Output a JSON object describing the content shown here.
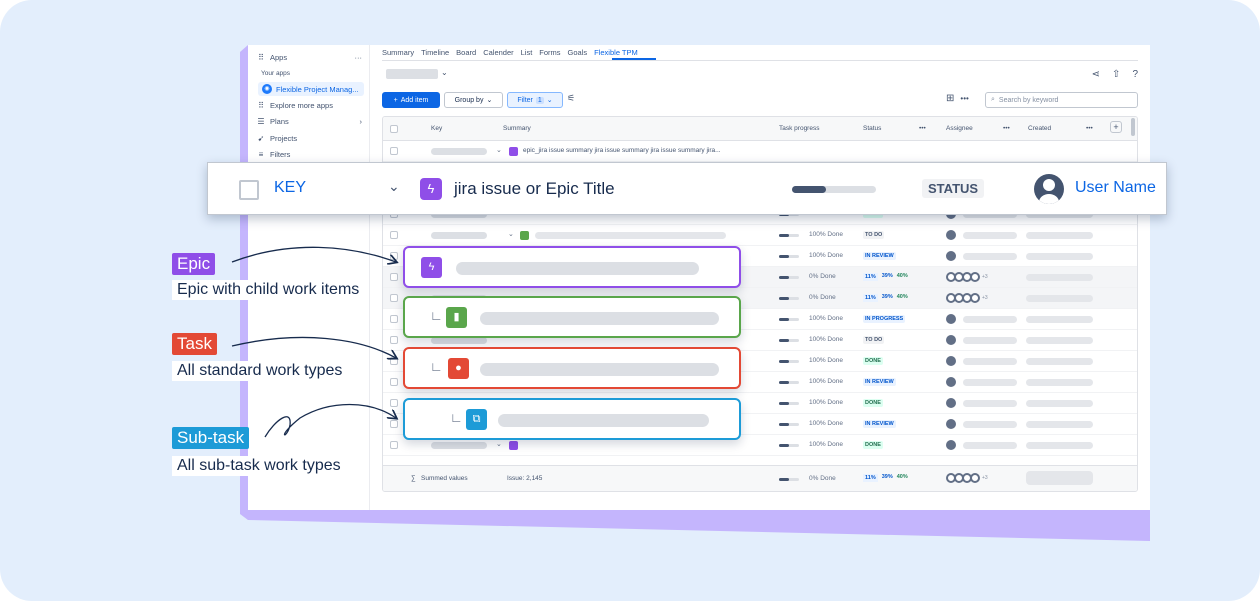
{
  "colors": {
    "background": "#e3eefc",
    "accent": "#0c66e4",
    "epic": "#8f4ee8",
    "story": "#5aa64b",
    "bug": "#e34935",
    "subtask": "#1d9bd7",
    "slab": "#c4b5fd"
  },
  "sidebar": {
    "apps": "Apps",
    "more": "···",
    "your_apps": "Your apps",
    "app_name": "Flexible Project Manag...",
    "explore": "Explore more apps",
    "plans": "Plans",
    "projects": "Projects",
    "filters": "Filters"
  },
  "tabs": [
    "Summary",
    "Timeline",
    "Board",
    "Calender",
    "List",
    "Forms",
    "Goals",
    "Flexible TPM"
  ],
  "toolbar": {
    "add_item": "Add item",
    "group_by": "Group by",
    "filter": "Filter",
    "filter_count": "1",
    "more": "•••",
    "search_placeholder": "Search by keyword"
  },
  "table": {
    "headers": {
      "key": "Key",
      "summary": "Summary",
      "task_progress": "Task progress",
      "status": "Status",
      "assignee": "Assignee",
      "created": "Created",
      "col_more": "•••"
    },
    "first_row_summary": "epic_jira issue summary jira issue summary jira issue summary jira...",
    "rows": [
      {
        "progress": "100% Done",
        "status": "IN PROGRESS",
        "kind": "prog"
      },
      {
        "progress": "100% Done",
        "status": "DONE",
        "kind": "done"
      },
      {
        "progress": "100% Done",
        "status": "TO DO",
        "kind": "todo"
      },
      {
        "progress": "100% Done",
        "status": "IN REVIEW",
        "kind": "rev"
      },
      {
        "progress": "0% Done",
        "status": "pct",
        "kind": "pct"
      },
      {
        "progress": "0% Done",
        "status": "pct",
        "kind": "pct"
      },
      {
        "progress": "100% Done",
        "status": "IN PROGRESS",
        "kind": "prog"
      },
      {
        "progress": "100% Done",
        "status": "TO DO",
        "kind": "todo"
      },
      {
        "progress": "100% Done",
        "status": "DONE",
        "kind": "done"
      },
      {
        "progress": "100% Done",
        "status": "IN REVIEW",
        "kind": "rev"
      },
      {
        "progress": "100% Done",
        "status": "DONE",
        "kind": "done"
      },
      {
        "progress": "100% Done",
        "status": "IN REVIEW",
        "kind": "rev"
      },
      {
        "progress": "100% Done",
        "status": "DONE",
        "kind": "done"
      }
    ],
    "pct": {
      "a": "11%",
      "b": "39%",
      "c": "40%"
    },
    "avatar_extra": "+3",
    "footer": {
      "label": "Summed values",
      "issue_count": "Issue: 2,145",
      "progress": "0% Done"
    }
  },
  "zoom_row": {
    "key": "KEY",
    "title": "jira issue or Epic Title",
    "status": "STATUS",
    "user": "User Name"
  },
  "labels": {
    "epic": {
      "tag": "Epic",
      "desc": "Epic with child work items"
    },
    "task": {
      "tag": "Task",
      "desc": "All standard work types"
    },
    "subtask": {
      "tag": "Sub-task",
      "desc": "All sub-task work types"
    }
  }
}
